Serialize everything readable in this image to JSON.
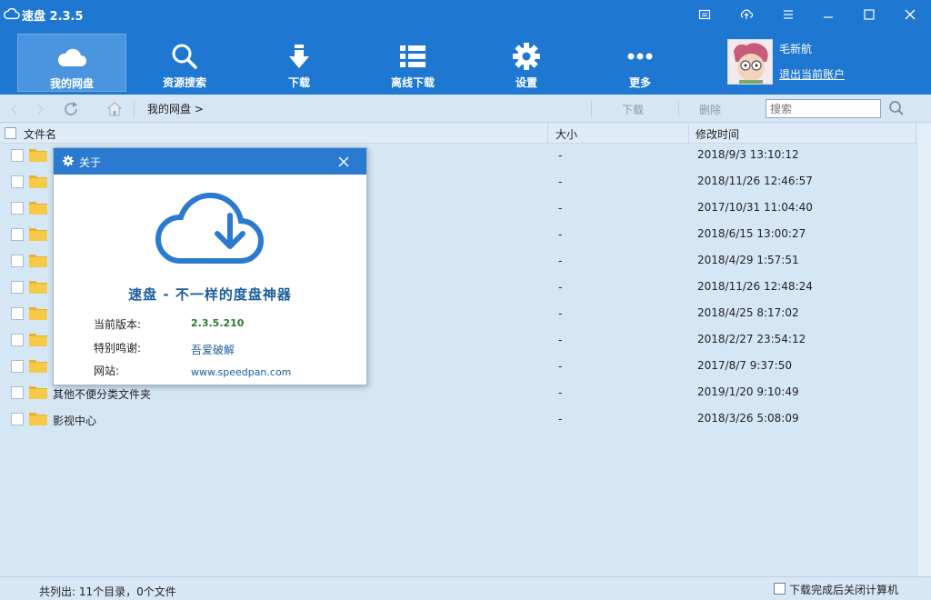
{
  "window": {
    "title": "速盘 2.3.5"
  },
  "toolbar": {
    "items": [
      {
        "label": "我的网盘",
        "icon": "cloud-icon",
        "active": true
      },
      {
        "label": "资源搜索",
        "icon": "search-icon"
      },
      {
        "label": "下载",
        "icon": "download-icon"
      },
      {
        "label": "离线下载",
        "icon": "list-icon"
      },
      {
        "label": "设置",
        "icon": "gear-icon"
      },
      {
        "label": "更多",
        "icon": "more-icon"
      }
    ]
  },
  "user": {
    "name": "毛新航",
    "logout_label": "退出当前账户"
  },
  "navbar": {
    "breadcrumb": "我的网盘 >",
    "download_label": "下载",
    "delete_label": "删除",
    "search_placeholder": "搜索"
  },
  "columns": {
    "name": "文件名",
    "size": "大小",
    "time": "修改时间"
  },
  "files": [
    {
      "name": "",
      "size": "-",
      "time": "2018/9/3 13:10:12"
    },
    {
      "name": "",
      "size": "-",
      "time": "2018/11/26 12:46:57"
    },
    {
      "name": "",
      "size": "-",
      "time": "2017/10/31 11:04:40"
    },
    {
      "name": "",
      "size": "-",
      "time": "2018/6/15 13:00:27"
    },
    {
      "name": "",
      "size": "-",
      "time": "2018/4/29 1:57:51"
    },
    {
      "name": "",
      "size": "-",
      "time": "2018/11/26 12:48:24"
    },
    {
      "name": "",
      "size": "-",
      "time": "2018/4/25 8:17:02"
    },
    {
      "name": "",
      "size": "-",
      "time": "2018/2/27 23:54:12"
    },
    {
      "name": "",
      "size": "-",
      "time": "2017/8/7 9:37:50"
    },
    {
      "name": "其他不便分类文件夹",
      "size": "-",
      "time": "2019/1/20 9:10:49"
    },
    {
      "name": "影视中心",
      "size": "-",
      "time": "2018/3/26 5:08:09"
    }
  ],
  "status": {
    "summary": "共列出: 11个目录，0个文件",
    "shutdown_label": "下载完成后关闭计算机"
  },
  "about_dialog": {
    "title": "关于",
    "slogan": "速盘 - 不一样的度盘神器",
    "version_label": "当前版本:",
    "version_value": "2.3.5.210",
    "thanks_label": "特别鸣谢:",
    "thanks_value": "吾爱破解",
    "website_label": "网站:",
    "website_value": "www.speedpan.com"
  },
  "colors": {
    "accent": "#1e78d2",
    "list_bg": "#d5e6f5",
    "folder": "#f5c342"
  }
}
